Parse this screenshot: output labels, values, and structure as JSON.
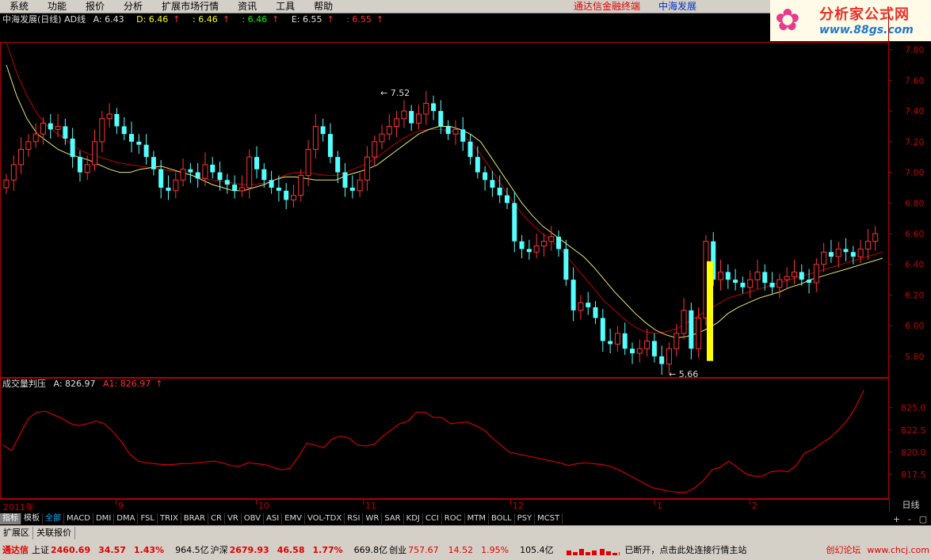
{
  "menu": {
    "items": [
      "系统",
      "功能",
      "报价",
      "分析",
      "扩展市场行情",
      "资讯",
      "工具",
      "帮助"
    ],
    "brand": "通达信金融终端",
    "stock_name": "中海发展"
  },
  "logo": {
    "title": "分析家公式网",
    "url": "www.88gs.com"
  },
  "main_chart": {
    "title": "中海发展(日线) AD线",
    "values": [
      {
        "label": "A: 6.43",
        "color": "#e0e0e0"
      },
      {
        "label": "D: 6.46",
        "color": "#ffff00"
      },
      {
        "label": ": 6.46",
        "color": "#ffff00"
      },
      {
        "label": ": 6.46",
        "color": "#00ff00"
      },
      {
        "label": "E: 6.55",
        "color": "#e0e0e0"
      },
      {
        "label": ": 6.55",
        "color": "#ff3030"
      }
    ],
    "y_ticks": [
      "7.80",
      "7.60",
      "7.40",
      "7.20",
      "7.00",
      "6.80",
      "6.60",
      "6.40",
      "6.20",
      "6.00",
      "5.80"
    ],
    "high_annotation": "7.52",
    "low_annotation": "5.66"
  },
  "indicator": {
    "title": "成交量判压",
    "value_a": "A: 826.97",
    "value_a1": "A1: 826.97",
    "y_ticks": [
      "825.0",
      "822.5",
      "820.0",
      "817.5"
    ]
  },
  "time_axis": {
    "labels": [
      "2011年",
      "9",
      "10",
      "11",
      "12",
      "1",
      "2"
    ],
    "period": "日线"
  },
  "indicator_tabs": [
    "指标",
    "模板",
    "全部",
    "MACD",
    "DMI",
    "DMA",
    "FSL",
    "TRIX",
    "BRAR",
    "CR",
    "VR",
    "OBV",
    "ASI",
    "EMV",
    "VOL-TDX",
    "RSI",
    "WR",
    "SAR",
    "KDJ",
    "CCI",
    "ROC",
    "MTM",
    "BOLL",
    "PSY",
    "MCST"
  ],
  "ext_tabs": [
    "扩展区",
    "关联报价"
  ],
  "scroll": {
    "plus": "+",
    "minus": "-",
    "right": "▢"
  },
  "status": {
    "app": "通达信",
    "sh_label": "上证",
    "sh_value": "2460.69",
    "sh_change": "34.57",
    "sh_pct": "1.43%",
    "sh_amount": "964.5亿",
    "hs_label": "沪深",
    "hs_value": "2679.93",
    "hs_change": "46.58",
    "hs_pct": "1.77%",
    "hs_amount": "669.8亿",
    "cy_label": "创业",
    "cy_value": "757.67",
    "cy_change": "14.52",
    "cy_pct": "1.95%",
    "cy_amount": "105.4亿",
    "message": "已断开，点击此处连接行情主站",
    "forum": "创幻论坛",
    "forum_url": "www.chcj.com"
  },
  "chart_data": [
    {
      "type": "candlestick",
      "title": "中海发展(日线) AD线",
      "ylim": [
        5.66,
        7.85
      ],
      "y_ticks": [
        7.8,
        7.6,
        7.4,
        7.2,
        7.0,
        6.8,
        6.6,
        6.4,
        6.2,
        6.0,
        5.8
      ],
      "x_labels": [
        "2011年",
        "9",
        "10",
        "11",
        "12",
        "1",
        "2"
      ],
      "close": [
        6.95,
        7.05,
        7.15,
        7.2,
        7.25,
        7.32,
        7.28,
        7.3,
        7.22,
        7.1,
        7.0,
        7.05,
        7.2,
        7.35,
        7.38,
        7.3,
        7.25,
        7.2,
        7.18,
        7.1,
        7.02,
        6.9,
        6.88,
        6.95,
        7.02,
        7.0,
        6.96,
        7.05,
        7.0,
        6.95,
        6.92,
        6.88,
        6.9,
        7.1,
        7.02,
        6.95,
        6.9,
        6.88,
        6.82,
        6.85,
        6.98,
        7.15,
        7.3,
        7.25,
        7.1,
        7.0,
        6.9,
        6.88,
        6.95,
        7.1,
        7.2,
        7.25,
        7.3,
        7.35,
        7.4,
        7.32,
        7.38,
        7.45,
        7.4,
        7.3,
        7.25,
        7.28,
        7.2,
        7.1,
        7.0,
        6.95,
        6.9,
        6.85,
        6.8,
        6.55,
        6.5,
        6.48,
        6.52,
        6.55,
        6.58,
        6.5,
        6.3,
        6.1,
        6.15,
        6.12,
        6.05,
        5.9,
        5.88,
        5.95,
        5.85,
        5.82,
        5.85,
        5.9,
        5.8,
        5.75,
        5.85,
        5.95,
        6.1,
        5.85,
        6.05,
        6.55,
        6.3,
        6.35,
        6.3,
        6.28,
        6.25,
        6.3,
        6.35,
        6.28,
        6.25,
        6.3,
        6.32,
        6.35,
        6.3,
        6.28,
        6.4,
        6.48,
        6.45,
        6.5,
        6.48,
        6.45,
        6.5,
        6.55,
        6.6
      ],
      "ma_yellow": [
        7.7,
        7.5,
        7.35,
        7.25,
        7.2,
        7.15,
        7.12,
        7.1,
        7.08,
        7.05,
        7.02,
        7.0,
        7.0,
        7.02,
        7.03,
        7.04,
        7.02,
        7.0,
        6.98,
        6.95,
        6.92,
        6.9,
        6.88,
        6.88,
        6.9,
        6.92,
        6.95,
        6.97,
        6.97,
        6.96,
        6.95,
        6.95,
        6.95,
        6.98,
        7.0,
        7.02,
        7.05,
        7.1,
        7.15,
        7.2,
        7.25,
        7.28,
        7.3,
        7.3,
        7.28,
        7.25,
        7.2,
        7.1,
        7.0,
        6.9,
        6.8,
        6.72,
        6.65,
        6.6,
        6.55,
        6.5,
        6.45,
        6.38,
        6.3,
        6.22,
        6.15,
        6.08,
        6.02,
        5.97,
        5.94,
        5.92,
        5.93,
        5.95,
        5.98,
        6.02,
        6.08,
        6.12,
        6.15,
        6.18,
        6.2,
        6.22,
        6.25,
        6.27,
        6.3,
        6.32,
        6.34,
        6.36,
        6.38,
        6.4,
        6.42,
        6.44
      ],
      "ma_red": [
        7.85,
        7.65,
        7.5,
        7.38,
        7.3,
        7.25,
        7.2,
        7.15,
        7.12,
        7.1,
        7.08,
        7.06,
        7.05,
        7.04,
        7.03,
        7.02,
        7.01,
        7.0,
        6.98,
        6.96,
        6.95,
        6.94,
        6.93,
        6.92,
        6.92,
        6.93,
        6.95,
        6.98,
        7.0,
        7.0,
        6.99,
        6.98,
        6.98,
        7.0,
        7.03,
        7.06,
        7.1,
        7.15,
        7.2,
        7.24,
        7.27,
        7.28,
        7.28,
        7.27,
        7.25,
        7.2,
        7.12,
        7.02,
        6.92,
        6.82,
        6.73,
        6.66,
        6.6,
        6.55,
        6.48,
        6.4,
        6.32,
        6.24,
        6.16,
        6.1,
        6.04,
        5.99,
        5.96,
        5.95,
        5.96,
        5.98,
        6.02,
        6.06,
        6.1,
        6.14,
        6.18,
        6.2,
        6.22,
        6.24,
        6.26,
        6.28,
        6.3,
        6.32,
        6.34,
        6.36,
        6.38,
        6.4,
        6.42,
        6.44,
        6.46,
        6.48
      ]
    },
    {
      "type": "line",
      "title": "成交量判压",
      "ylim": [
        815.0,
        828.0
      ],
      "y_ticks": [
        825.0,
        822.5,
        820.0,
        817.5
      ],
      "values": [
        820.8,
        820.2,
        822.0,
        823.8,
        824.5,
        824.6,
        824.2,
        823.8,
        823.2,
        823.0,
        823.2,
        823.5,
        823.2,
        822.3,
        821.2,
        819.8,
        819.0,
        818.8,
        818.7,
        818.6,
        818.6,
        818.7,
        818.7,
        818.8,
        818.9,
        819.0,
        818.8,
        818.5,
        818.4,
        818.8,
        818.7,
        818.6,
        818.3,
        818.0,
        818.2,
        819.5,
        821.0,
        820.8,
        820.5,
        821.5,
        821.8,
        821.6,
        820.8,
        820.7,
        820.9,
        821.8,
        822.5,
        823.2,
        823.5,
        824.5,
        824.5,
        823.9,
        823.9,
        823.2,
        823.3,
        823.4,
        823.0,
        822.5,
        821.6,
        820.8,
        820.0,
        819.8,
        819.6,
        819.4,
        819.2,
        819.0,
        818.8,
        818.5,
        818.7,
        818.8,
        818.7,
        818.6,
        818.4,
        818.0,
        817.5,
        817.0,
        816.5,
        816.0,
        815.8,
        815.6,
        815.5,
        815.5,
        816.0,
        816.8,
        818.0,
        818.3,
        819.0,
        818.3,
        817.6,
        817.3,
        817.3,
        817.8,
        817.9,
        817.8,
        818.5,
        819.9,
        820.3,
        821.0,
        821.6,
        822.5,
        823.5,
        825.0,
        826.97
      ]
    }
  ]
}
